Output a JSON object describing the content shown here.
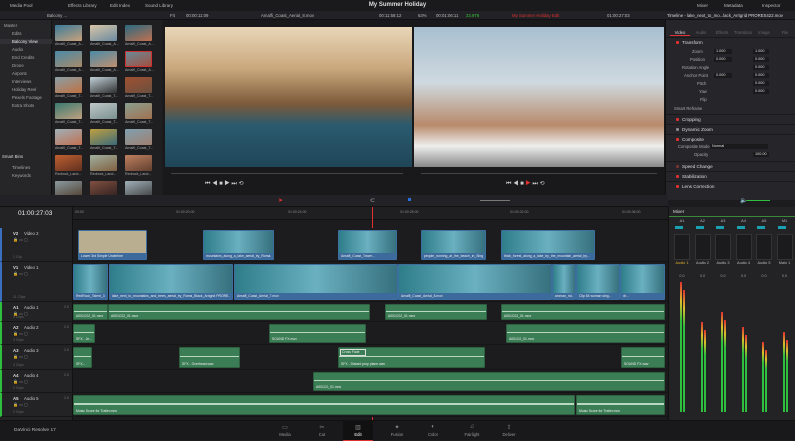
{
  "menu": {
    "items": [
      "Media Pool",
      "Effects Library",
      "Edit Index",
      "Sound Library"
    ],
    "title": "My Summer Holiday",
    "right": [
      "Mixer",
      "Metadata",
      "Inspector"
    ]
  },
  "toolbar": {
    "bin": "Balcony ...",
    "fit": "Fit",
    "source_tc": "00:00:11:09",
    "source_clip": "Amalfi_Coast_Aerial_8.mov",
    "source_dur": "00:11:58:12",
    "zoom": "63%",
    "prog_tc": "00:01:06:11",
    "speed": "23.976",
    "timeline_name": "My Summer Holiday Edit",
    "prog_dur": "01:00:27:03",
    "inspector_title": "Timeline - lake_next_to_mo...lack_Arrigrid PRORES422.mov"
  },
  "bins": {
    "master": "Master",
    "items": [
      "Edits",
      "Balcony View",
      "Audio",
      "End Credits",
      "Drone",
      "Airports",
      "Interviews",
      "Holiday Reel",
      "Pexels Footage",
      "Extra Shots"
    ],
    "selected": "Balcony View",
    "smart_bins": "Smart Bins",
    "smart_items": [
      "Timelines",
      "Keywords"
    ]
  },
  "thumbnails": [
    "Amalfi_Coast_A...",
    "Amalfi_Coast_A...",
    "Amalfi_Coast_A...",
    "Amalfi_Coast_A...",
    "Amalfi_Coast_A...",
    "Amalfi_Coast_A...",
    "Amalfi_Coast_T...",
    "Amalfi_Coast_T...",
    "Amalfi_Coast_T...",
    "Amalfi_Coast_T...",
    "Amalfi_Coast_T...",
    "Amalfi_Coast_T...",
    "Amalfi_Coast_T...",
    "Amalfi_Coast_T...",
    "Amalfi_Coast_T...",
    "Redrock_Land...",
    "Redrock_Land...",
    "Redrock_Land..."
  ],
  "inspector": {
    "tabs": [
      "Video",
      "Audio",
      "Effects",
      "Transition",
      "Image",
      "File"
    ],
    "active_tab": "Video",
    "transform": {
      "label": "Transform",
      "zoom_label": "Zoom",
      "zoom_x": "1.000",
      "zoom_y": "1.000",
      "position_label": "Position",
      "pos_x": "0.000",
      "pos_y": "0.000",
      "rotation_label": "Rotation Angle",
      "rotation": "0.000",
      "anchor_label": "Anchor Point",
      "anchor_x": "0.000",
      "anchor_y": "0.000",
      "pitch_label": "Pitch",
      "pitch": "0.000",
      "yaw_label": "Yaw",
      "yaw": "0.000",
      "flip_label": "Flip"
    },
    "smart_reframe": "Smart Reframe",
    "cropping": "Cropping",
    "dynamic_zoom": "Dynamic Zoom",
    "composite": "Composite",
    "composite_mode_label": "Composite Mode",
    "composite_mode": "Normal",
    "opacity_label": "Opacity",
    "opacity": "100.00",
    "speed_change": "Speed Change",
    "stabilization": "Stabilization",
    "lens_correction": "Lens Correction"
  },
  "timeline": {
    "timecode": "01:00:27:03",
    "ruler": [
      "00:00",
      "01:00:20:00",
      "01:00:24:00",
      "01:00:28:00",
      "01:00:32:00",
      "01:00:36:00"
    ],
    "tracks": [
      {
        "id": "V2",
        "name": "Video 2",
        "clips": "1 Clip"
      },
      {
        "id": "V1",
        "name": "Video 1",
        "clips": "11 Clips"
      },
      {
        "id": "A1",
        "name": "Audio 1",
        "vol": "2.0",
        "clips": "5 Clips"
      },
      {
        "id": "A2",
        "name": "Audio 2",
        "vol": "2.0",
        "clips": "3 Clips"
      },
      {
        "id": "A3",
        "name": "Audio 3",
        "vol": "2.0",
        "clips": "3 Clips"
      },
      {
        "id": "A4",
        "name": "Audio 4",
        "vol": "2.0",
        "clips": "2 Clips"
      },
      {
        "id": "A5",
        "name": "Audio 5",
        "vol": "2.0",
        "clips": "2 Clips"
      }
    ],
    "v2": [
      "Lower 3rd Simple Underline",
      "mountains_along_a_lake_aerial_by_Roma...",
      "Amalfi_Coast_Tower...",
      "people_running_at_the_beach_in_Sing...",
      "thick_forest_along_a_lake_by_the_mountain_aerial_by..."
    ],
    "v1": [
      "RedRock_Talent_3...",
      "lake_next_to_mountains_and_trees_aerial_by_Roma_Black_Arrigrid PRORE...",
      "Amalfi_Coast_Aerial_7.mov",
      "Amalfi_Coast_Aerial_8.mov",
      "woman_rid...",
      "Clip 84 woman sing...",
      "dr..."
    ],
    "a1": [
      "A001C02_01.mov",
      "A001C02_01.mov",
      "A001C02_01.mov",
      "A001C02_01.mov"
    ],
    "a2": [
      "SFX - Je...",
      "SOUND FX.mov",
      "A001C0_01.mov"
    ],
    "a3": [
      "SFX...",
      "SFX - Overhead.wav",
      "SFX - Distant prop plane.wav",
      "SOUND FX.wav"
    ],
    "cross_fade": "Cross Fade",
    "a4": [
      "A001C0_01.mov"
    ],
    "a5": [
      "Music Score for Trailer.mov",
      "Music Score for Trailer.mov"
    ]
  },
  "mixer": {
    "title": "Mixer",
    "channels": [
      "A1",
      "A2",
      "A3",
      "A4",
      "A5",
      "M1"
    ],
    "names": [
      "Audio 1",
      "Audio 2",
      "Audio 3",
      "Audio 4",
      "Audio 5",
      "Main 1"
    ],
    "values": [
      "0.0",
      "0.0",
      "0.0",
      "0.0",
      "0.0",
      "0.0"
    ]
  },
  "pages": [
    "Media",
    "Cut",
    "Edit",
    "Fusion",
    "Color",
    "Fairlight",
    "Deliver"
  ],
  "active_page": "Edit",
  "app": "DaVinci Resolve 17",
  "colors": {
    "accent": "#e03030",
    "video_clip": "#3c6a9c",
    "audio_clip": "#3b7d55"
  }
}
